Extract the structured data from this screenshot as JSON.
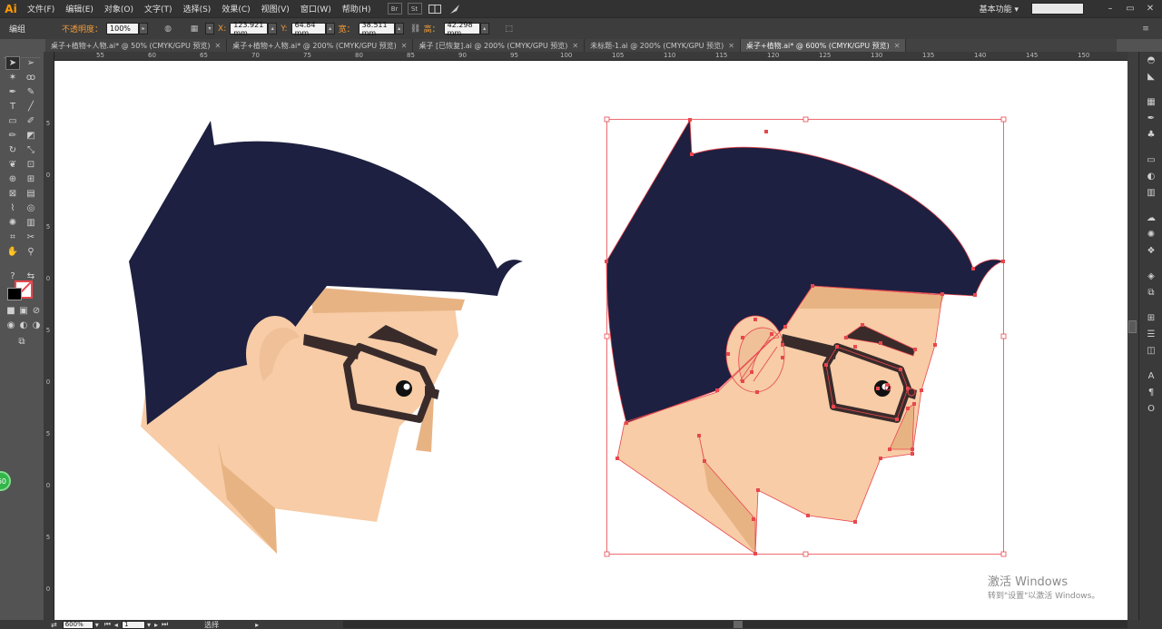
{
  "app": {
    "logo": "Ai"
  },
  "menu": [
    "文件(F)",
    "编辑(E)",
    "对象(O)",
    "文字(T)",
    "选择(S)",
    "效果(C)",
    "视图(V)",
    "窗口(W)",
    "帮助(H)"
  ],
  "menubar_icons": {
    "br": "Br",
    "st": "St"
  },
  "workspace": {
    "label": "基本功能"
  },
  "window_controls": {
    "minimize": "–",
    "maximize": "▭",
    "close": "✕"
  },
  "control_bar": {
    "mode": "编组",
    "opacity_label": "不透明度：",
    "opacity_value": "100%",
    "x_label": "X:",
    "x_value": "123.921 mm",
    "y_label": "Y:",
    "y_value": "64.84 mm",
    "w_label": "宽：",
    "w_value": "38.511 mm",
    "h_label": "高：",
    "h_value": "42.298 mm"
  },
  "tabs": [
    {
      "label": "桌子+植物+人物.ai* @ 50% (CMYK/GPU 预览)",
      "active": false
    },
    {
      "label": "桌子+植物+人物.ai* @ 200% (CMYK/GPU 预览)",
      "active": false
    },
    {
      "label": "桌子 [已恢复].ai @ 200% (CMYK/GPU 预览)",
      "active": false
    },
    {
      "label": "未标题-1.ai @ 200% (CMYK/GPU 预览)",
      "active": false
    },
    {
      "label": "桌子+植物.ai* @ 600% (CMYK/GPU 预览)",
      "active": true
    }
  ],
  "ruler_top": [
    "55",
    "60",
    "65",
    "70",
    "75",
    "80",
    "85",
    "90",
    "95",
    "100",
    "105",
    "110",
    "115",
    "120",
    "125",
    "130",
    "135",
    "140",
    "145",
    "150"
  ],
  "ruler_left": [
    "5",
    "0",
    "5",
    "0",
    "5",
    "0",
    "5",
    "0",
    "5",
    "0"
  ],
  "colors": {
    "hair": "#1d2040",
    "skin": "#f7cca6",
    "skin_shadow": "#e8b383",
    "ear_inner": "#f0c098",
    "glasses": "#3a2b2b",
    "eye": "#111111",
    "selection": "#e8474e",
    "accent_orange": "#f29b38"
  },
  "watermark": {
    "title": "激活 Windows",
    "subtitle": "转到\"设置\"以激活 Windows。"
  },
  "status_bar": {
    "zoom": "600%",
    "page": "1",
    "tool_status": "选择"
  },
  "badge": {
    "label": "60"
  }
}
